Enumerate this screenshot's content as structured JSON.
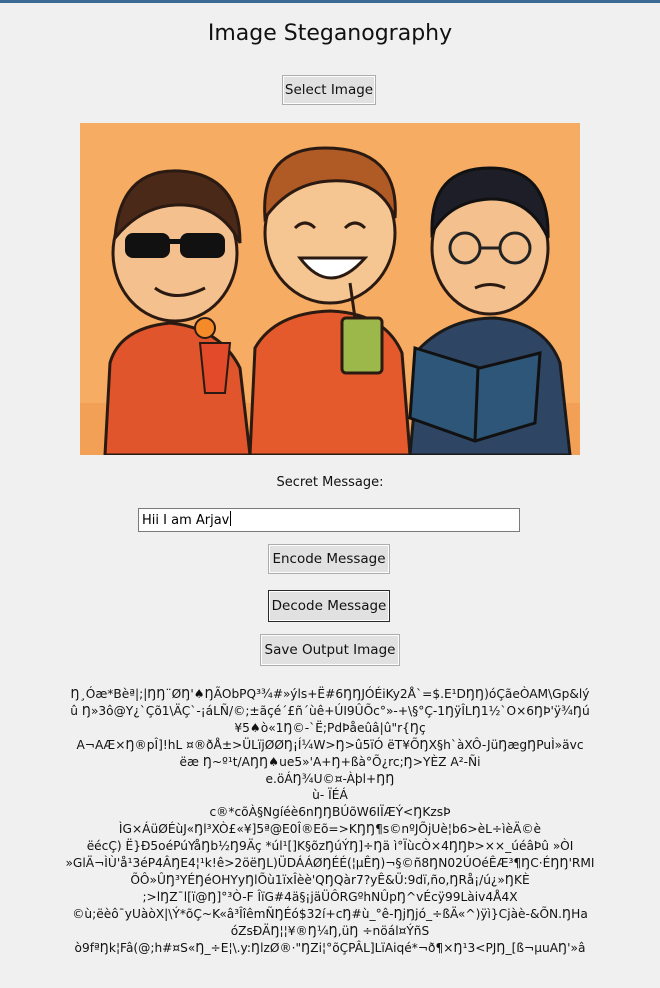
{
  "window": {
    "title": "Image Steganography",
    "accent_color": "#3c6a94",
    "background_color": "#f0f0f0"
  },
  "buttons": {
    "select_image": "Select Image",
    "encode_message": "Encode Message",
    "decode_message": "Decode Message",
    "save_output_image": "Save Output Image"
  },
  "image": {
    "description_icon": "cartoon-three-boys-image",
    "background_color": "#f6ac63"
  },
  "secret_message": {
    "label": "Secret Message:",
    "value": "Hii I am Arjav"
  },
  "output_text": [
    "Ŋ¸Óæ*Bèª|;|ŊŊ¨ØŊ'♠ŊÃObPQ³¾#»ýls+Ë#6ŊŊJÓÉiKy2Å`=$.E¹DŊŊ)óÇãeÒAM\\Gp&lý",
    "û Ŋ»3ô@Y¿`Çõ1\\ÄÇ`-¡áLÑ/©;±ãçé´£ñ´ùê+ÚI9ÛÕc°»-+\\§°Ç-1ŊÿÎLŊ1½`O×6ŊÞ'ÿ¾Ŋú",
    "¥5♠ò«1Ŋ©-`Ë;PdÞåeûâ|û\"r{Ŋç",
    "A¬AÆ×Ŋ®pÎ]!hL  ¤®ðÅ±>ÜLïjØØŊ¡Í¼W>Ŋ>û5ïÓ  ëT¥ÕŊX§h`àXÔ-JüŊægŊPuÌ»ävc",
    "ëæ Ŋ~º¹t/AŊŊ♠ue5»'A+Ŋ+ßà°Õ¿rc;Ŋ>YÈZ    A²-Ñi",
    "e.öÁŊ¾U©¤-Àþl+ŊŊ",
    "ù- ÏÉÁ",
    "c®*cõÀ§Ngíéè6nŊŊBÚõW6IÏÆÝ<ŊKzsÞ",
    "ÌG×ÁüØÉùJ«Ŋl³XÒ£«¥]5ª@E0Î®Eõ=>KŊŊ¶s©nºJÕjUè¦b6>èL÷ìèÄ©è",
    "ëécÇ) Ë}Ð5oéPúYåŊb½Ŋ9Äç  *úl¹[]K§õzŊúÝŊ]÷Ŋä  ì°ÏùcÒ×4ŊŊÞ>××_úéâÞû         »ÒI",
    "»GlÄ¬ÌÙ'å¹3éP4ÂŊE4¦¹k!ê>2öëŊL)ÜDÁÁØŊÉÉ(¦µÊŊ)¬§©ñ8ŊN02ÚOéÊÆ³¶ŊC·ÉŊŊ'RMI",
    "ÕÔ»ÛŊ³YÉŊéOHYyŊlÕù1ïxÎèè'QŊQàr7?yÊ&Ü:9dï,ño,ŊRå¡/ú¿»ŊKÈ",
    ";>lŊZ¯l[ï@Ŋ]°³Ò-F ÎïG#4ä§¡jäÜÔRGºhNÛpŊ^vÉcÿ99Làiv4Å4X",
    "©ù;ëèô¯yUàòX|\\Ý*õÇ~K«â³ÎîêmÑŊÉó$32í+cŊ#ù_°ê-ŊjŊjó_÷ßÄ«^)ÿì}Cjàè-&ÕN.ŊHa",
    "óZsÐÄŊ¦¦¥®Ŋ¼Ŋ,üŊ          ÷nöál¤ÝñS",
    "ò9fªŊk¦Fâ(@;h#¤S«Ŋ_÷E¦\\.y:ŊlzØ®·\"ŊZi¦°õÇPÂL]LïAiqé*¬ð¶×Ŋ¹3<PJŊ_[ß¬µuAŊ'»â"
  ]
}
